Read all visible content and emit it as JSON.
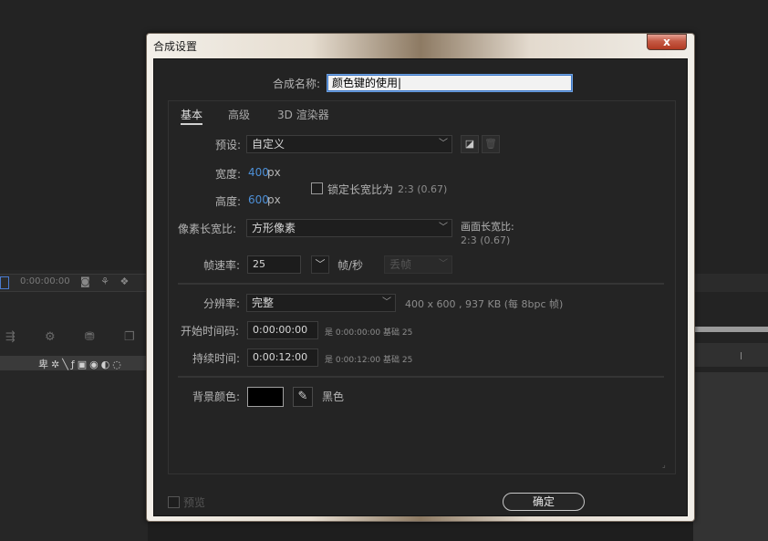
{
  "background": {
    "timecode": "0:00:00:00"
  },
  "dialog": {
    "title": "合成设置",
    "close_label": "x",
    "name_label": "合成名称:",
    "name_value": "颜色键的使用",
    "tabs": [
      {
        "label": "基本",
        "active": true
      },
      {
        "label": "高级",
        "active": false
      },
      {
        "label": "3D 渲染器",
        "active": false
      }
    ],
    "preset": {
      "label": "预设:",
      "value": "自定义"
    },
    "width": {
      "label": "宽度:",
      "value": "400",
      "unit": "px"
    },
    "height": {
      "label": "高度:",
      "value": "600",
      "unit": "px"
    },
    "lock_aspect": {
      "label": "锁定长宽比为",
      "ratio": "2:3 (0.67)",
      "checked": false
    },
    "pixel_aspect": {
      "label": "像素长宽比:",
      "value": "方形像素"
    },
    "frame_aspect": {
      "label": "画面长宽比:",
      "value": "2:3 (0.67)"
    },
    "frame_rate": {
      "label": "帧速率:",
      "value": "25",
      "unit": "帧/秒",
      "drop_frame": "丢帧"
    },
    "resolution": {
      "label": "分辨率:",
      "value": "完整",
      "info": "400 x 600 , 937 KB (每 8bpc 帧)"
    },
    "start_timecode": {
      "label": "开始时间码:",
      "value": "0:00:00:00",
      "is_text": "是 0:00:00:00",
      "base_text": "基础 25"
    },
    "duration": {
      "label": "持续时间:",
      "value": "0:00:12:00",
      "is_text": "是 0:00:12:00",
      "base_text": "基础 25"
    },
    "bg_color": {
      "label": "背景颜色:",
      "name": "黑色",
      "color": "#000000"
    },
    "preview": {
      "label": "预览",
      "checked": false
    },
    "ok_label": "确定"
  }
}
